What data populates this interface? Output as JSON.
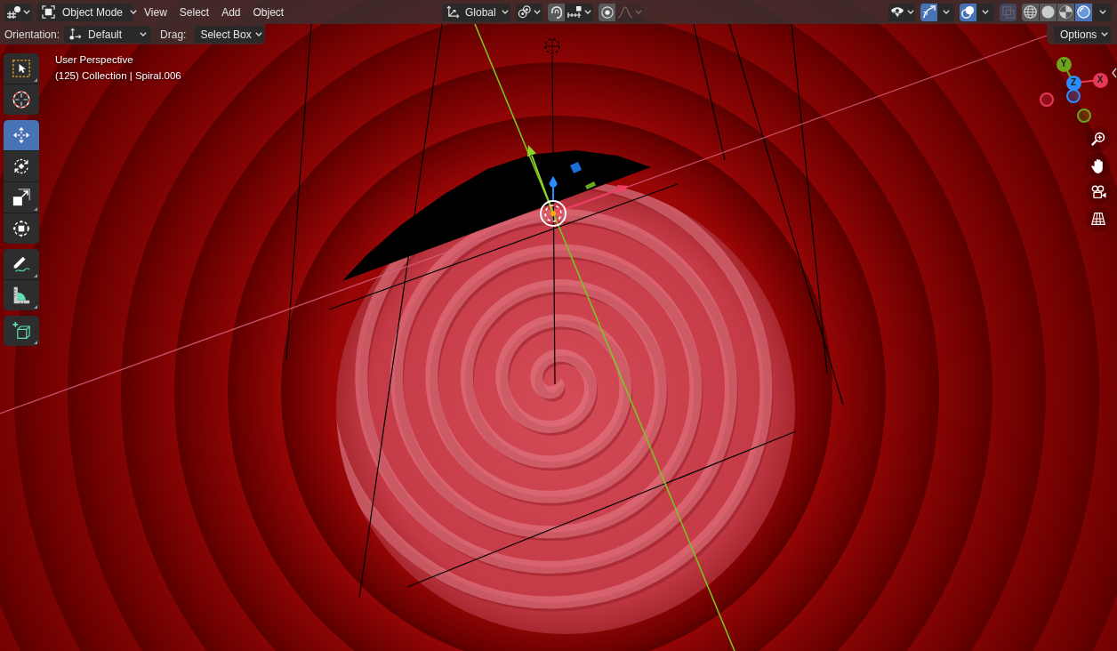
{
  "header": {
    "mode_menu": {
      "label": "Object Mode"
    },
    "menus": [
      "View",
      "Select",
      "Add",
      "Object"
    ],
    "orientation_menu": {
      "label": "Global"
    },
    "snap": {
      "on": false
    },
    "proportional_editing": {
      "on": false
    },
    "falloff": {
      "disabled": true
    },
    "gizmos": {
      "on": true
    },
    "overlays": {
      "on": true
    },
    "xray": {
      "disabled": true
    },
    "shading_modes": [
      {
        "kind": "wireframe",
        "selected": false
      },
      {
        "kind": "solid",
        "selected": false
      },
      {
        "kind": "material",
        "selected": false
      },
      {
        "kind": "rendered",
        "selected": true
      }
    ]
  },
  "tool_settings": {
    "orientation": {
      "label": "Orientation:",
      "value": "Default"
    },
    "drag": {
      "label": "Drag:",
      "value": "Select Box"
    },
    "options": {
      "label": "Options"
    }
  },
  "toolbar": [
    {
      "tools": [
        {
          "kind": "select_box",
          "selected": false
        },
        {
          "kind": "cursor",
          "selected": false
        }
      ]
    },
    {
      "tools": [
        {
          "kind": "move",
          "selected": true
        },
        {
          "kind": "rotate",
          "selected": false
        },
        {
          "kind": "scale",
          "selected": false
        },
        {
          "kind": "transform",
          "selected": false
        }
      ]
    },
    {
      "tools": [
        {
          "kind": "annotate",
          "selected": false
        },
        {
          "kind": "measure",
          "selected": false
        }
      ]
    },
    {
      "tools": [
        {
          "kind": "add_cube",
          "selected": false
        }
      ]
    }
  ],
  "viewport_info": {
    "view": "User Perspective",
    "object": "(125) Collection | Spiral.006"
  },
  "navigation_gizmo": {
    "axes": [
      {
        "label": "X",
        "color": "#e8385a"
      },
      {
        "label": "Y",
        "color": "#6ea31c"
      },
      {
        "label": "Z",
        "color": "#2a8cff"
      }
    ]
  }
}
